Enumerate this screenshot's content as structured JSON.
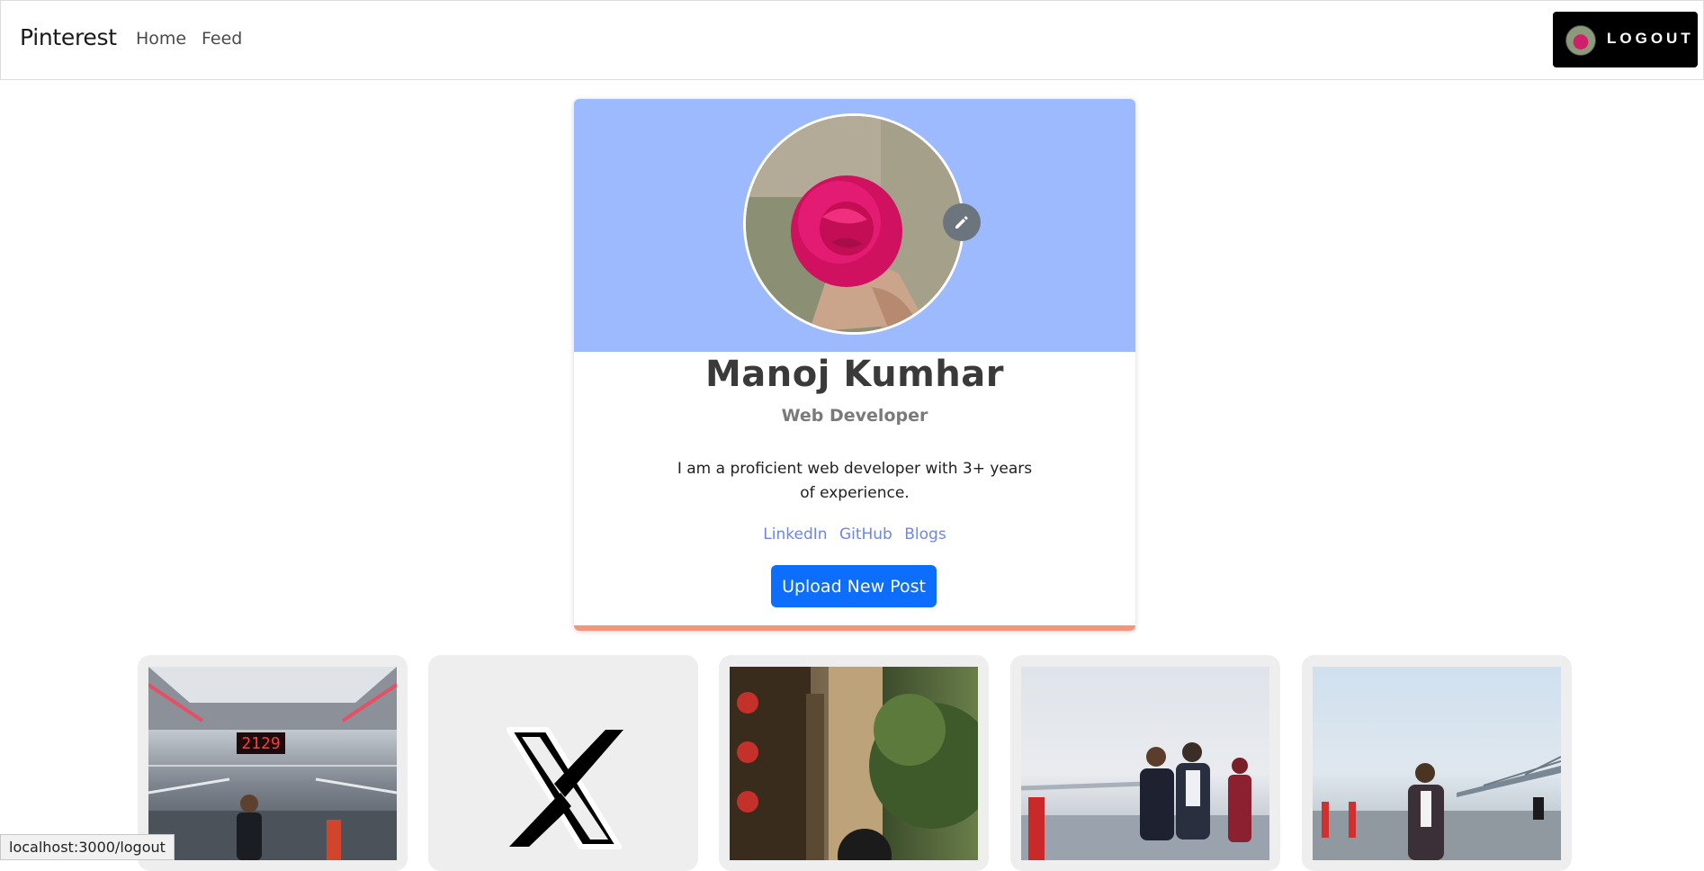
{
  "navbar": {
    "brand": "Pinterest",
    "links": [
      "Home",
      "Feed"
    ],
    "logout_label": "LOGOUT"
  },
  "profile": {
    "name": "Manoj Kumhar",
    "role": "Web Developer",
    "bio": "I am a proficient web developer with 3+ years of experience.",
    "links": [
      "LinkedIn",
      "GitHub",
      "Blogs"
    ],
    "upload_label": "Upload New Post"
  },
  "posts": [
    {
      "subject": "station-overbridge-photo",
      "sign": "2129"
    },
    {
      "subject": "x-logo"
    },
    {
      "subject": "plants-restaurant-photo"
    },
    {
      "subject": "friends-riverside-photo"
    },
    {
      "subject": "bridge-riverside-photo"
    }
  ],
  "status_bar": {
    "url": "localhost:3000/logout"
  },
  "colors": {
    "cover": "#9cbafd",
    "primary": "#0d6efd",
    "link": "#6d86e8",
    "accent_bottom": "#f4957c",
    "logout_bg": "#000000"
  }
}
